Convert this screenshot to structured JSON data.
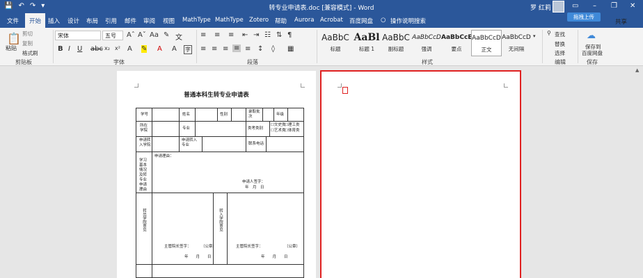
{
  "window": {
    "title": "转专业申请表.doc [兼容模式] - Word",
    "user": "罗 红莉",
    "upload_label": "拖拽上传",
    "share_label": "共享"
  },
  "tabs": [
    "文件",
    "开始",
    "插入",
    "设计",
    "布局",
    "引用",
    "邮件",
    "审阅",
    "视图",
    "MathType",
    "MathType",
    "Zotero",
    "帮助",
    "Aurora",
    "Acrobat",
    "百度网盘",
    "操作说明搜索"
  ],
  "ribbon": {
    "clipboard": {
      "paste": "粘贴",
      "cut": "剪切",
      "copy": "复制",
      "format_painter": "格式刷",
      "label": "剪贴板"
    },
    "font": {
      "name": "宋体",
      "size": "五号",
      "label": "字体"
    },
    "paragraph": {
      "label": "段落"
    },
    "styles": {
      "label": "样式",
      "items": [
        {
          "preview": "AaBbC",
          "name": "标题"
        },
        {
          "preview": "AaBl",
          "name": "标题 1"
        },
        {
          "preview": "AaBbC",
          "name": "副标题"
        },
        {
          "preview": "AaBbCcD",
          "name": "强调"
        },
        {
          "preview": "AaBbCcE",
          "name": "要点"
        },
        {
          "preview": "AaBbCcD",
          "name": "正文"
        },
        {
          "preview": "AaBbCcD",
          "name": "无间隔"
        }
      ]
    },
    "editing": {
      "find": "查找",
      "replace": "替换",
      "select": "选择",
      "label": "编辑"
    },
    "save": {
      "line1": "保存到",
      "line2": "百度网盘",
      "label": "保存"
    }
  },
  "document": {
    "title": "普通本科生转专业申请表",
    "row1": [
      "学号",
      "姓名",
      "性别",
      "录取批次",
      "年级"
    ],
    "row2": {
      "origin": "所在学院",
      "major": "专业",
      "category": "类考类别",
      "opts": [
        "文史类",
        "理工类",
        "艺术类",
        "体育类"
      ]
    },
    "row3": {
      "apply_college": "申请转入学院",
      "apply_major": "申请转入专业",
      "phone": "联系电话"
    },
    "row4": {
      "side": "学习基本情况及转专业申请理由",
      "reason": "申请理由：",
      "signature": "申请人签字：",
      "date": "年　月　日"
    },
    "row5": {
      "left_side": "转出学院意见",
      "right_side": "转入学院意见",
      "sign": "主管院长签字：",
      "seal": "（公章）",
      "date": "年　　月　　日"
    }
  }
}
